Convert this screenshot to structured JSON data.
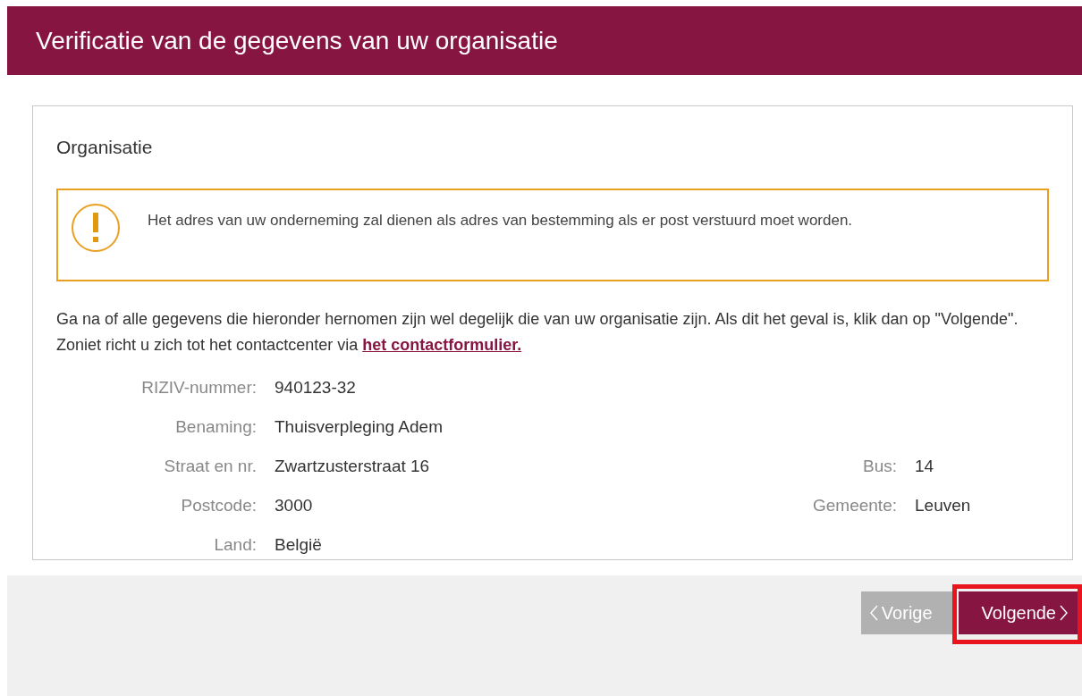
{
  "header": {
    "title": "Verificatie van de gegevens van uw organisatie"
  },
  "section": {
    "title": "Organisatie",
    "alert": {
      "kind": "warning",
      "text": "Het adres van uw onderneming zal dienen als adres van bestemming als er post verstuurd moet worden."
    },
    "intro": {
      "text": "Ga na of alle gegevens die hieronder hernomen zijn wel degelijk die van uw organisatie zijn. Als dit het geval is, klik dan op \"Volgende\". Zoniet richt u zich tot het contactcenter via ",
      "link": "het contactformulier."
    },
    "rows": [
      {
        "fields": [
          {
            "label": "RIZIV-nummer:",
            "value": "940123-32"
          }
        ]
      },
      {
        "fields": [
          {
            "label": "Benaming:",
            "value": "Thuisverpleging Adem"
          }
        ]
      },
      {
        "fields": [
          {
            "label": "Straat en nr.",
            "value": "Zwartzusterstraat 16"
          },
          {
            "label": "Bus:",
            "value": "14"
          }
        ]
      },
      {
        "fields": [
          {
            "label": "Postcode:",
            "value": "3000"
          },
          {
            "label": "Gemeente:",
            "value": "Leuven"
          }
        ]
      },
      {
        "fields": [
          {
            "label": "Land:",
            "value": "België"
          }
        ]
      }
    ]
  },
  "footer": {
    "buttons": [
      {
        "label": "Vorige",
        "kind": "back",
        "highlighted": false
      },
      {
        "label": "Volgende",
        "kind": "next",
        "highlighted": true
      }
    ]
  }
}
